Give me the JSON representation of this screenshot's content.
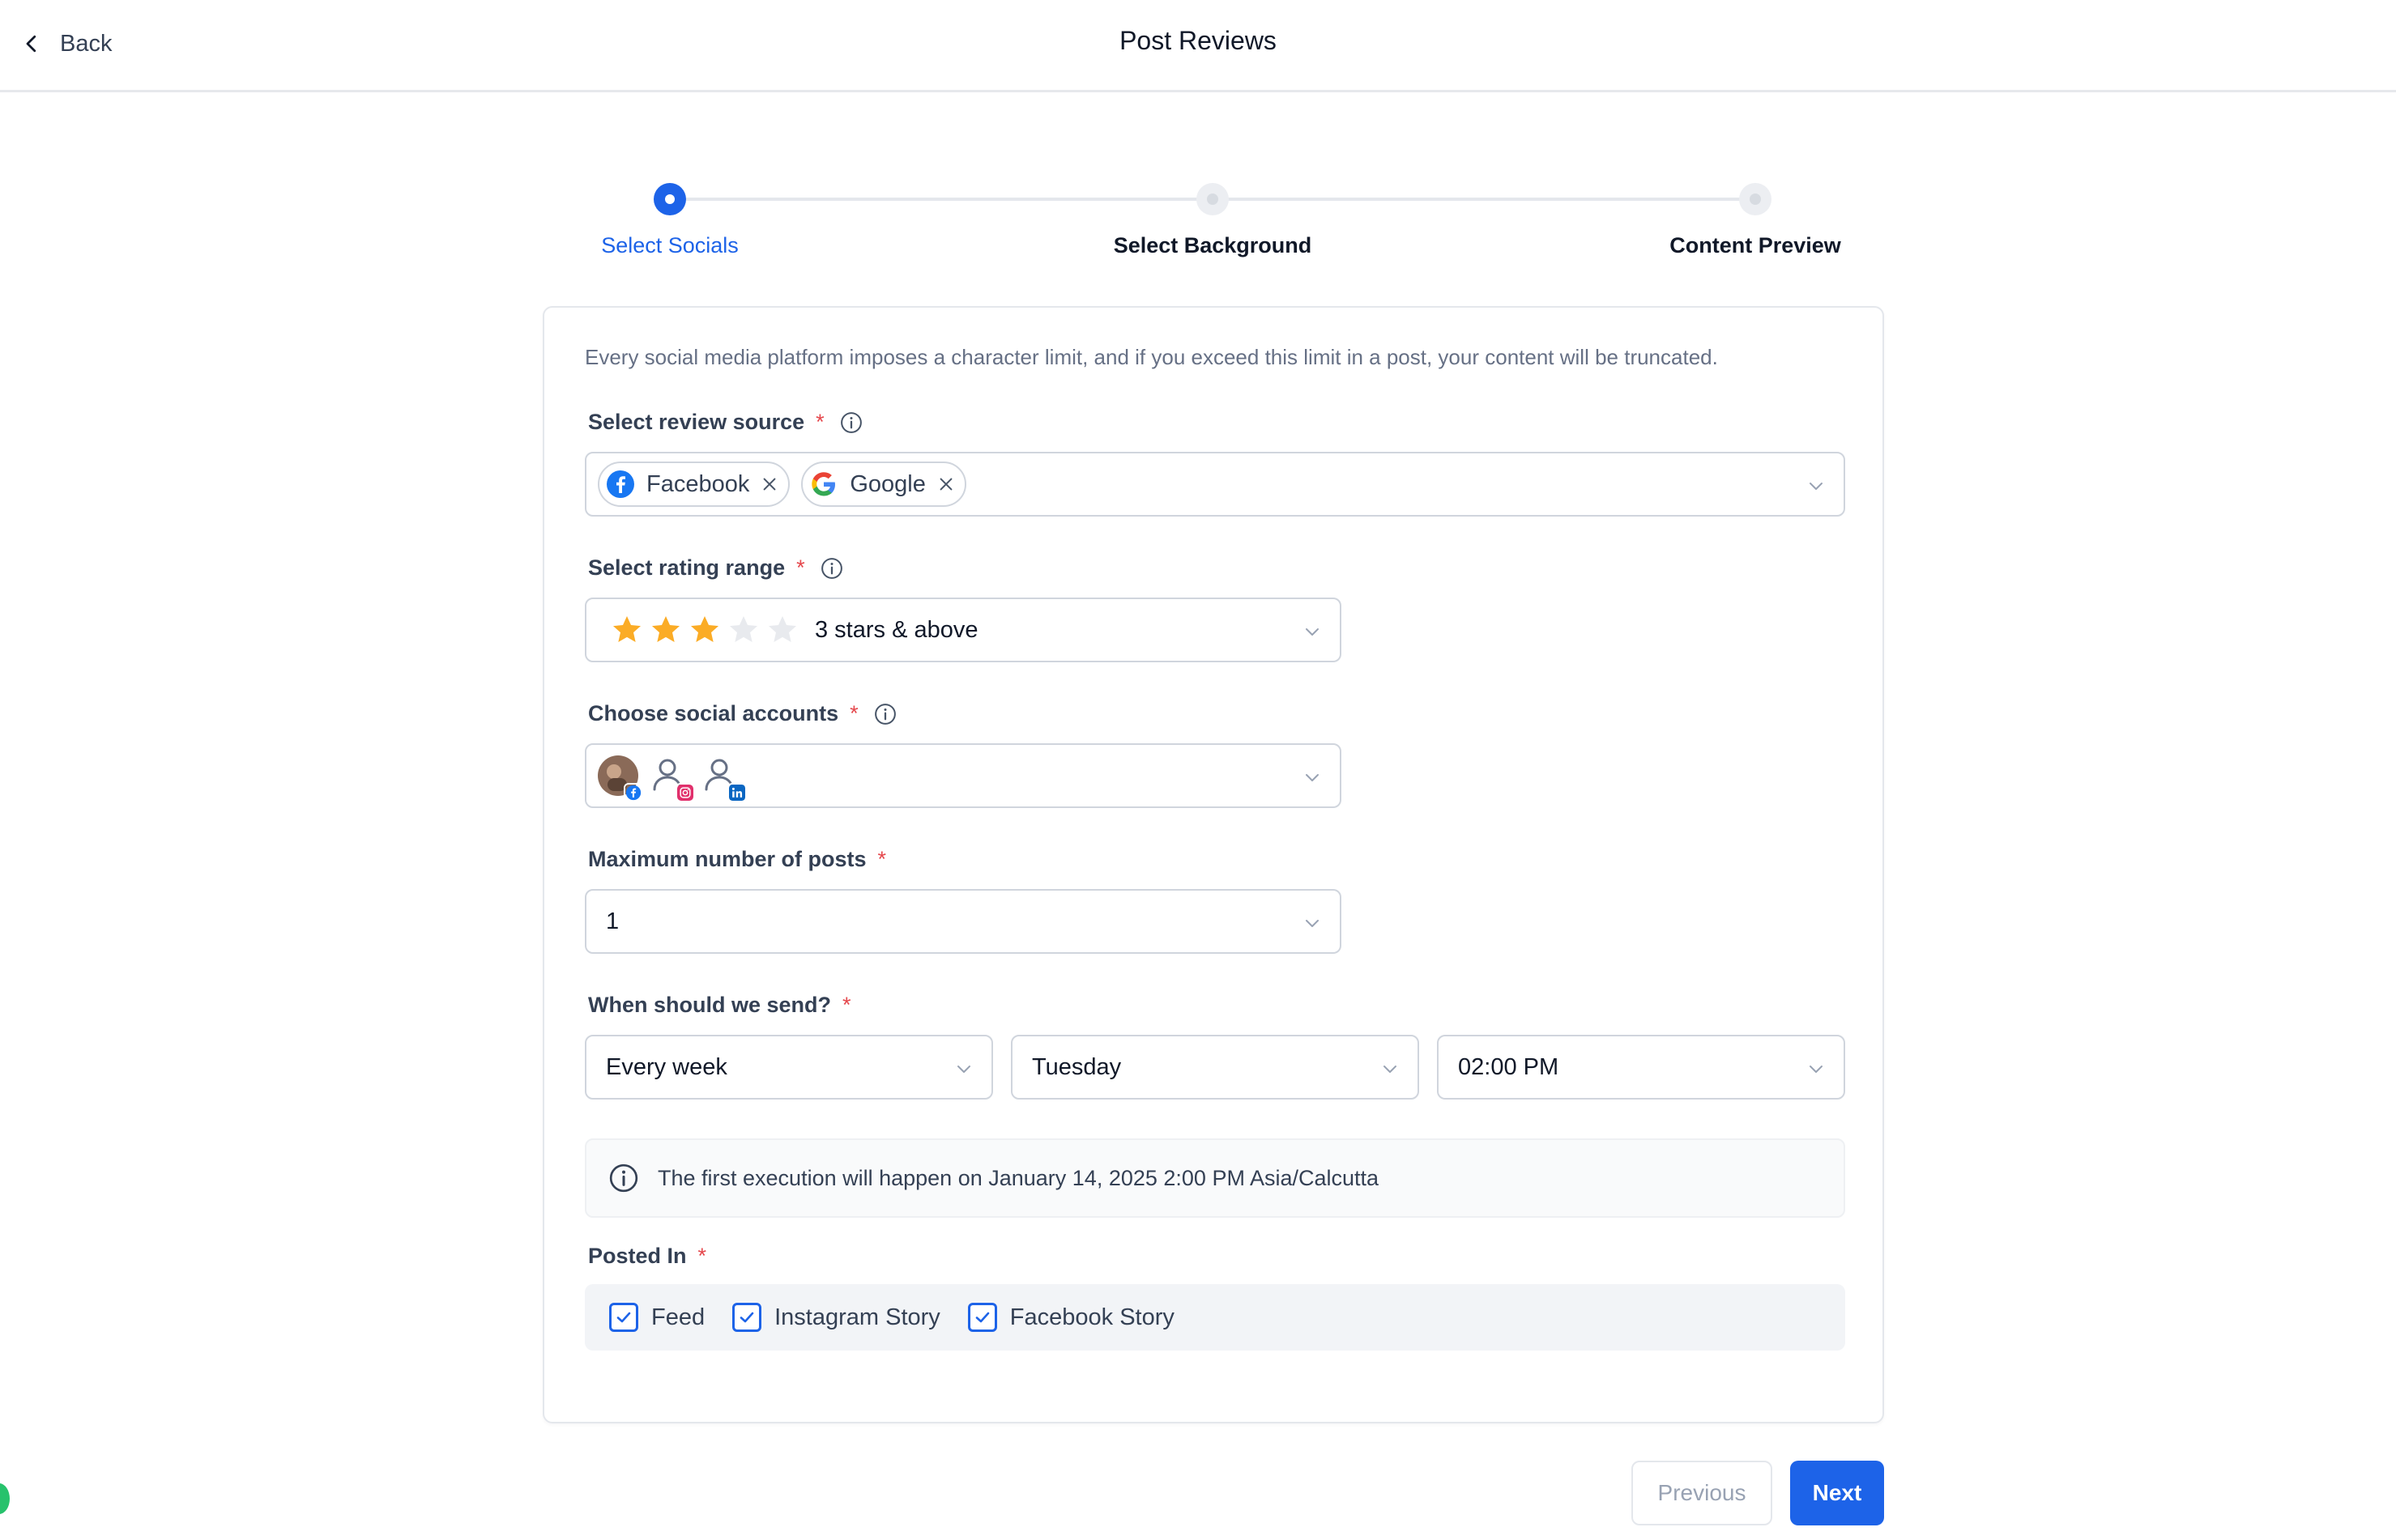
{
  "header": {
    "back_label": "Back",
    "title": "Post Reviews"
  },
  "stepper": {
    "steps": [
      {
        "label": "Select Socials",
        "state": "active"
      },
      {
        "label": "Select Background",
        "state": "pending"
      },
      {
        "label": "Content Preview",
        "state": "pending"
      }
    ]
  },
  "form": {
    "note": "Every social media platform imposes a character limit, and if you exceed this limit in a post, your content will be truncated.",
    "review_source": {
      "label": "Select review source",
      "required_mark": "*",
      "chips": [
        {
          "label": "Facebook",
          "icon": "facebook-logo-icon"
        },
        {
          "label": "Google",
          "icon": "google-logo-icon"
        }
      ]
    },
    "rating_range": {
      "label": "Select rating range",
      "required_mark": "*",
      "stars_filled": 3,
      "stars_total": 5,
      "value": "3 stars & above"
    },
    "social_accounts": {
      "label": "Choose social accounts",
      "required_mark": "*",
      "accounts": [
        {
          "icon": "user-photo-avatar",
          "network": "facebook"
        },
        {
          "icon": "user-placeholder-icon",
          "network": "instagram"
        },
        {
          "icon": "user-placeholder-icon",
          "network": "linkedin"
        }
      ]
    },
    "max_posts": {
      "label": "Maximum number of posts",
      "required_mark": "*",
      "value": "1"
    },
    "schedule": {
      "label": "When should we send?",
      "required_mark": "*",
      "frequency": "Every week",
      "day": "Tuesday",
      "time": "02:00 PM"
    },
    "execution_note": "The first execution will happen on January 14, 2025 2:00 PM Asia/Calcutta",
    "posted_in": {
      "label": "Posted In",
      "required_mark": "*",
      "options": [
        {
          "label": "Feed",
          "checked": true
        },
        {
          "label": "Instagram Story",
          "checked": true
        },
        {
          "label": "Facebook Story",
          "checked": true
        }
      ]
    }
  },
  "footer": {
    "previous_label": "Previous",
    "next_label": "Next"
  },
  "colors": {
    "primary": "#1d63e8",
    "star_filled": "#fbac26",
    "star_empty": "#e8eaee",
    "required": "#e5484d"
  }
}
